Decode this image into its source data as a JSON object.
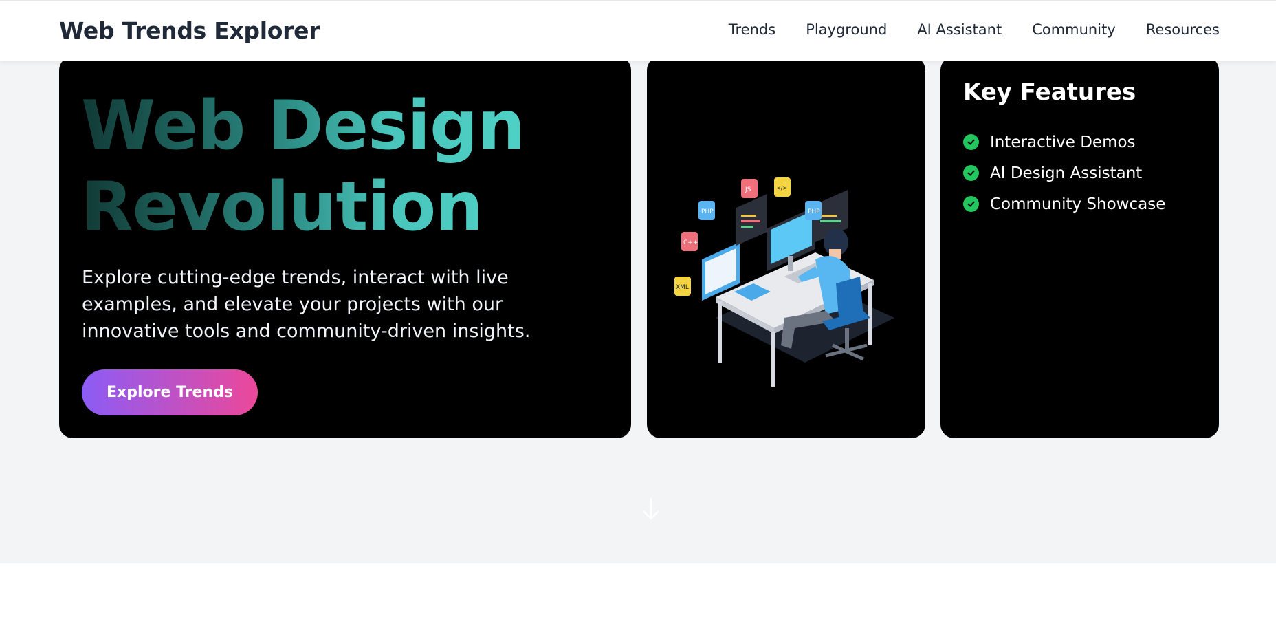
{
  "brand": {
    "title": "Web Trends Explorer"
  },
  "nav": {
    "items": [
      {
        "label": "Trends"
      },
      {
        "label": "Playground"
      },
      {
        "label": "AI Assistant"
      },
      {
        "label": "Community"
      },
      {
        "label": "Resources"
      }
    ]
  },
  "hero": {
    "title_line1": "Web Design",
    "title_line2": "Revolution",
    "description": "Explore cutting-edge trends, interact with live examples, and elevate your projects with our innovative tools and community-driven insights.",
    "cta_label": "Explore Trends"
  },
  "illustration": {
    "icon": "developer-at-desk-illustration",
    "badges": [
      "PHP",
      "JS",
      "</>",
      "C++",
      "PHP",
      "XML"
    ]
  },
  "features": {
    "title": "Key Features",
    "items": [
      {
        "label": "Interactive Demos"
      },
      {
        "label": "AI Design Assistant"
      },
      {
        "label": "Community Showcase"
      }
    ]
  },
  "scroll": {
    "icon": "arrow-down-icon"
  },
  "colors": {
    "accent_teal": "#4fd1c5",
    "cta_start": "#8b5cf6",
    "cta_end": "#ec4899",
    "check_green": "#22c55e"
  }
}
